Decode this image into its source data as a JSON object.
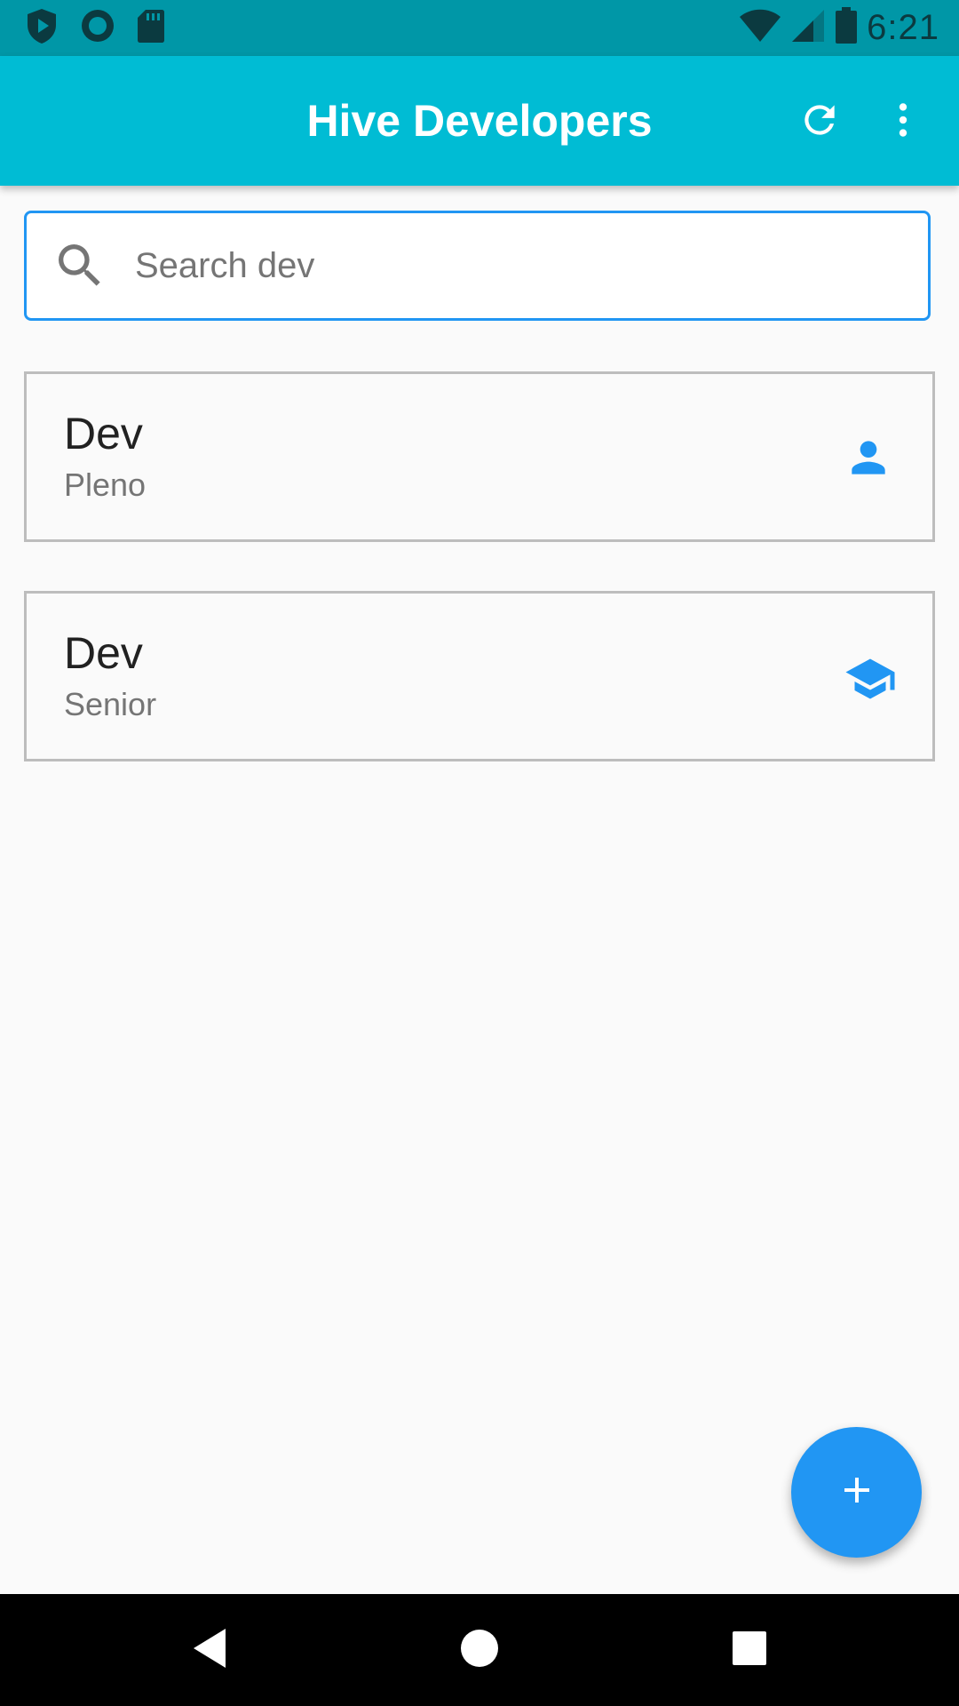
{
  "status_bar": {
    "time": "6:21",
    "left_icons": [
      "shield-play-icon",
      "circle-icon",
      "sd-card-icon"
    ],
    "right_icons": [
      "wifi-icon",
      "cell-signal-icon",
      "battery-icon"
    ]
  },
  "app_bar": {
    "title": "Hive Developers",
    "actions": [
      "refresh-icon",
      "more-vert-icon"
    ]
  },
  "search": {
    "placeholder": "Search dev",
    "value": ""
  },
  "developers": [
    {
      "name": "Dev",
      "level": "Pleno",
      "icon": "person-icon"
    },
    {
      "name": "Dev",
      "level": "Senior",
      "icon": "school-icon"
    }
  ],
  "fab": {
    "icon": "add-icon"
  },
  "nav": {
    "buttons": [
      "back-icon",
      "home-icon",
      "recents-icon"
    ]
  },
  "colors": {
    "status_bar": "#0097a7",
    "app_bar": "#00bcd4",
    "accent": "#2196f3",
    "background": "#fafafa"
  }
}
